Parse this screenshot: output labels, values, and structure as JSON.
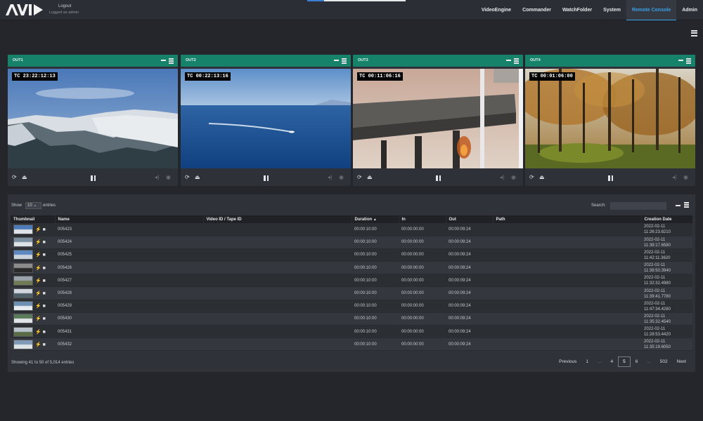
{
  "brand": {
    "logo": "AVID"
  },
  "user": {
    "logout": "Logout",
    "logged_as": "Logged as admin"
  },
  "nav": [
    {
      "label": "VideoEngine",
      "active": false
    },
    {
      "label": "Commander",
      "active": false
    },
    {
      "label": "WatchFolder",
      "active": false
    },
    {
      "label": "System",
      "active": false
    },
    {
      "label": "Remote Console",
      "active": true
    },
    {
      "label": "Admin",
      "active": false
    }
  ],
  "outputs": [
    {
      "label": "OUT1",
      "timecode": "TC 23:22:12:13",
      "scene": "snowy-mountain-valley"
    },
    {
      "label": "OUT2",
      "timecode": "TC 00:22:13:16",
      "scene": "ocean-boat-wake"
    },
    {
      "label": "OUT3",
      "timecode": "TC 00:11:06:16",
      "scene": "bridge-fire"
    },
    {
      "label": "OUT4",
      "timecode": "TC 00:01:06:00",
      "scene": "autumn-forest"
    }
  ],
  "table": {
    "show_label": "Show",
    "page_size": "10",
    "entries_label": "entries",
    "search_label": "Search:",
    "columns": {
      "thumbnail": "Thumbnail",
      "name": "Name",
      "video_id": "Video ID / Tape ID",
      "duration": "Duration",
      "in": "In",
      "out": "Out",
      "path": "Path",
      "creation_date": "Creation Date"
    },
    "rows": [
      {
        "name": "005423",
        "duration": "00:00:10:00",
        "in": "00:00:00:00",
        "out": "00:00:09:24",
        "date": "2022-02-11",
        "time": "11:26:23.8210"
      },
      {
        "name": "005424",
        "duration": "00:00:10:00",
        "in": "00:00:00:00",
        "out": "00:00:09:24",
        "date": "2022-02-11",
        "time": "11:38:17.6580"
      },
      {
        "name": "005425",
        "duration": "00:00:10:00",
        "in": "00:00:00:00",
        "out": "00:00:09:24",
        "date": "2022-02-11",
        "time": "11:42:11.3620"
      },
      {
        "name": "005426",
        "duration": "00:00:10:00",
        "in": "00:00:00:00",
        "out": "00:00:09:24",
        "date": "2022-02-11",
        "time": "11:38:50.3940"
      },
      {
        "name": "005427",
        "duration": "00:00:10:00",
        "in": "00:00:00:00",
        "out": "00:00:09:24",
        "date": "2022-02-11",
        "time": "11:32:32.4980"
      },
      {
        "name": "005428",
        "duration": "00:00:10:00",
        "in": "00:00:00:00",
        "out": "00:00:09:24",
        "date": "2022-02-11",
        "time": "11:39:41.7780"
      },
      {
        "name": "005429",
        "duration": "00:00:10:00",
        "in": "00:00:00:00",
        "out": "00:00:09:24",
        "date": "2022-02-11",
        "time": "11:47:34.4280"
      },
      {
        "name": "005430",
        "duration": "00:00:10:00",
        "in": "00:00:00:00",
        "out": "00:00:09:24",
        "date": "2022-02-11",
        "time": "11:35:32.4540"
      },
      {
        "name": "005431",
        "duration": "00:00:10:00",
        "in": "00:00:00:00",
        "out": "00:00:09:24",
        "date": "2022-02-11",
        "time": "11:28:53.4420"
      },
      {
        "name": "005432",
        "duration": "00:00:10:00",
        "in": "00:00:00:00",
        "out": "00:00:09:24",
        "date": "2022-02-11",
        "time": "11:35:19.6050"
      }
    ],
    "showing": "Showing 41 to 50 of 5,014 entries"
  },
  "pagination": {
    "previous": "Previous",
    "pages": [
      "1",
      "...",
      "4",
      "5",
      "6",
      "...",
      "502"
    ],
    "current": "5",
    "next": "Next"
  },
  "colors": {
    "accent_green": "#16826a",
    "accent_blue": "#3aa0e8",
    "background": "#24262c"
  }
}
